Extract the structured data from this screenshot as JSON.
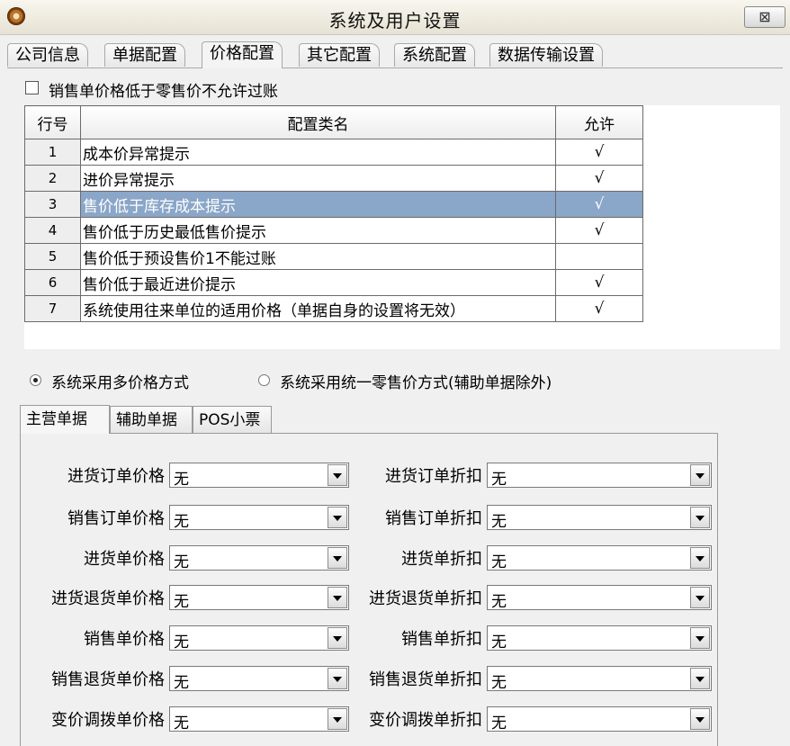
{
  "window": {
    "title": "系统及用户设置",
    "close_label": "⊠"
  },
  "top_tabs": [
    {
      "label": "公司信息"
    },
    {
      "label": "单据配置"
    },
    {
      "label": "价格配置"
    },
    {
      "label": "其它配置"
    },
    {
      "label": "系统配置"
    },
    {
      "label": "数据传输设置"
    }
  ],
  "active_top_tab": "价格配置",
  "sale_price_check": {
    "label": "销售单价格低于零售价不允许过账",
    "checked": false
  },
  "grid": {
    "headers": {
      "no": "行号",
      "name": "配置类名",
      "allow": "允许"
    },
    "rows": [
      {
        "no": "1",
        "name": "成本价异常提示",
        "allow": "√"
      },
      {
        "no": "2",
        "name": "进价异常提示",
        "allow": "√"
      },
      {
        "no": "3",
        "name": "售价低于库存成本提示",
        "allow": "√"
      },
      {
        "no": "4",
        "name": "售价低于历史最低售价提示",
        "allow": "√"
      },
      {
        "no": "5",
        "name": "售价低于预设售价1不能过账",
        "allow": ""
      },
      {
        "no": "6",
        "name": "售价低于最近进价提示",
        "allow": "√"
      },
      {
        "no": "7",
        "name": "系统使用往来单位的适用价格（单据自身的设置将无效）",
        "allow": "√"
      }
    ],
    "selected_row": "3"
  },
  "price_mode": {
    "option_multi": "系统采用多价格方式",
    "option_uniform": "系统采用统一零售价方式(辅助单据除外)",
    "selected": "系统采用多价格方式"
  },
  "sub_tabs": [
    {
      "label": "主营单据"
    },
    {
      "label": "辅助单据"
    },
    {
      "label": "POS小票"
    }
  ],
  "active_sub_tab": "主营单据",
  "fields": {
    "left": [
      {
        "label": "进货订单价格",
        "value": "无"
      },
      {
        "label": "销售订单价格",
        "value": "无"
      },
      {
        "label": "进货单价格",
        "value": "无"
      },
      {
        "label": "进货退货单价格",
        "value": "无"
      },
      {
        "label": "销售单价格",
        "value": "无"
      },
      {
        "label": "销售退货单价格",
        "value": "无"
      },
      {
        "label": "变价调拨单价格",
        "value": "无"
      }
    ],
    "right": [
      {
        "label": "进货订单折扣",
        "value": "无"
      },
      {
        "label": "销售订单折扣",
        "value": "无"
      },
      {
        "label": "进货单折扣",
        "value": "无"
      },
      {
        "label": "进货退货单折扣",
        "value": "无"
      },
      {
        "label": "销售单折扣",
        "value": "无"
      },
      {
        "label": "销售退货单折扣",
        "value": "无"
      },
      {
        "label": "变价调拨单折扣",
        "value": "无"
      }
    ]
  }
}
